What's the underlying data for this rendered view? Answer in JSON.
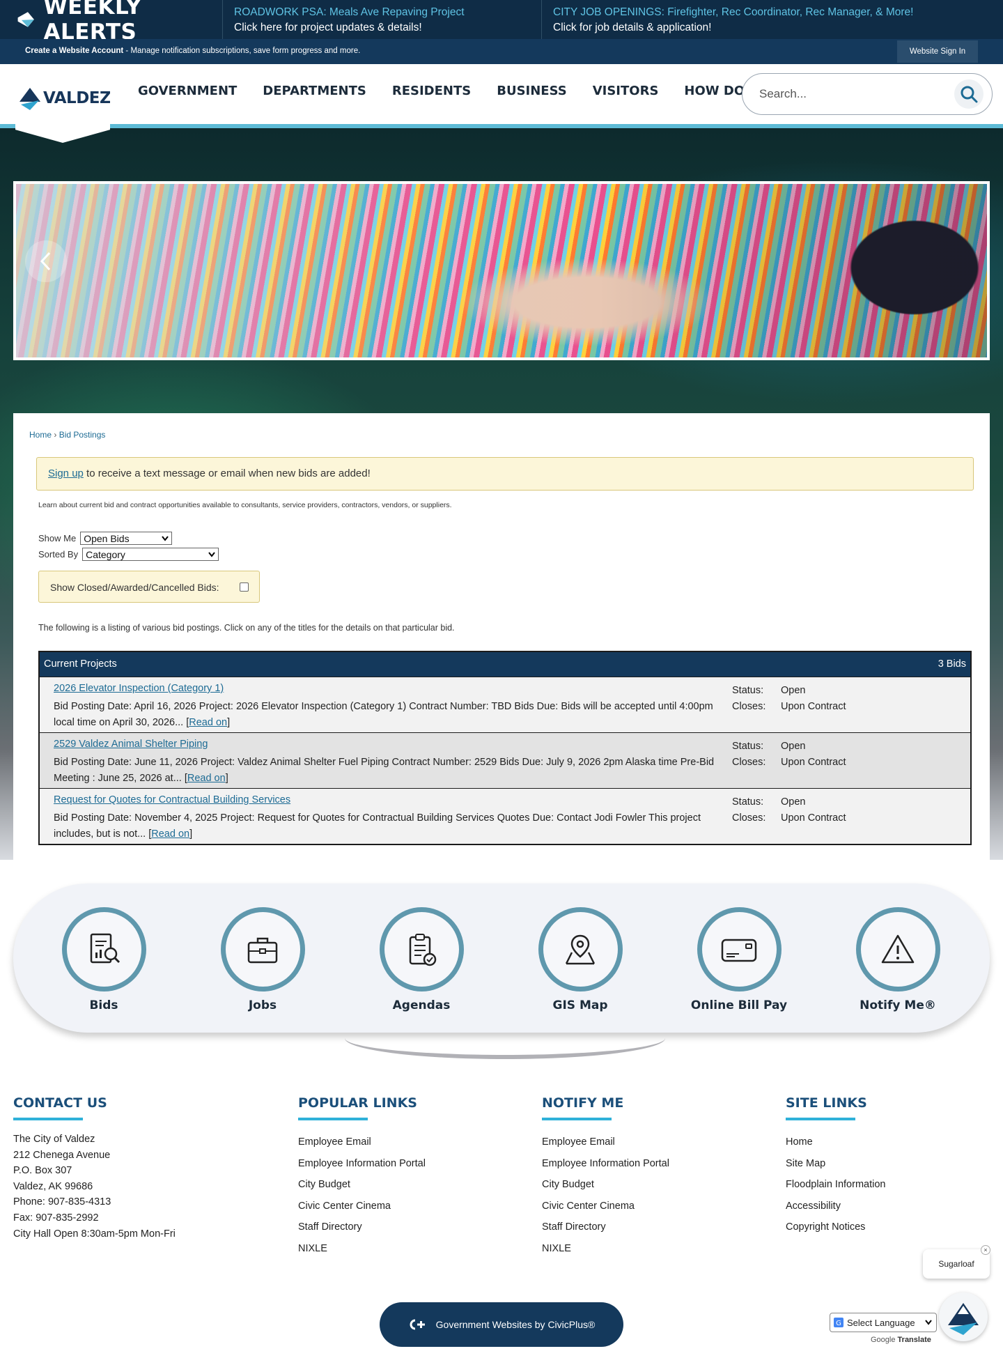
{
  "alerts": {
    "brand_title": "WEEKLY ALERTS",
    "items": [
      {
        "title": "ROADWORK PSA: Meals Ave Repaving Project",
        "subtitle": "Click here for project updates & details!"
      },
      {
        "title": "CITY JOB OPENINGS: Firefighter, Rec Coordinator, Rec Manager, & More!",
        "subtitle": "Click for job details & application!"
      }
    ]
  },
  "account": {
    "create_label": "Create a Website Account",
    "create_desc": " - Manage notification subscriptions, save form progress and more.",
    "signin_label": "Website Sign In"
  },
  "header": {
    "logo_text": "VALDEZ",
    "nav": [
      "GOVERNMENT",
      "DEPARTMENTS",
      "RESIDENTS",
      "BUSINESS",
      "VISITORS",
      "HOW DO I?"
    ],
    "search_placeholder": "Search..."
  },
  "hero": {
    "prev_icon": "chevron-left-icon"
  },
  "breadcrumb": {
    "home": "Home",
    "separator": " › ",
    "current": "Bid Postings"
  },
  "signup": {
    "link": "Sign up",
    "text": " to receive a text message or email when new bids are added!"
  },
  "intro_text": "Learn about current bid and contract opportunities available to consultants, service providers, contractors, vendors, or suppliers.",
  "filters": {
    "show_me_label": "Show Me",
    "show_me_value": "Open Bids",
    "sorted_by_label": "Sorted By",
    "sorted_by_value": "Category",
    "closed_label": "Show Closed/Awarded/Cancelled Bids:",
    "closed_checked": false
  },
  "listing_note": "The following is a listing of various bid postings. Click on any of the titles for the details on that particular bid.",
  "bids": {
    "category": "Current Projects",
    "count": "3 Bids",
    "status_label": "Status:",
    "closes_label": "Closes:",
    "read_on": "Read on",
    "rows": [
      {
        "title": "2026 Elevator Inspection (Category 1)",
        "desc": "Bid Posting Date: April 16, 2026 Project: 2026 Elevator Inspection (Category 1) Contract Number: TBD Bids Due: Bids will be accepted until 4:00pm local time on April 30, 2026... ",
        "status": "Open",
        "closes": "Upon Contract"
      },
      {
        "title": "2529 Valdez Animal Shelter Piping",
        "desc": "Bid Posting Date: June 11, 2026 Project: Valdez Animal Shelter Fuel Piping Contract Number: 2529 Bids Due: July 9, 2026 2pm Alaska time Pre-Bid Meeting : June 25, 2026 at... ",
        "status": "Open",
        "closes": "Upon Contract"
      },
      {
        "title": "Request for Quotes for Contractual Building Services",
        "desc": "Bid Posting Date: November 4, 2025 Project: Request for Quotes for Contractual Building Services Quotes Due: Contact Jodi Fowler This project includes, but is not... ",
        "status": "Open",
        "closes": "Upon Contract"
      }
    ]
  },
  "quick_links": [
    {
      "label": "Bids",
      "icon": "bids-document-icon"
    },
    {
      "label": "Jobs",
      "icon": "briefcase-icon"
    },
    {
      "label": "Agendas",
      "icon": "clipboard-check-icon"
    },
    {
      "label": "GIS Map",
      "icon": "map-pin-icon"
    },
    {
      "label": "Online Bill Pay",
      "icon": "credit-card-icon"
    },
    {
      "label": "Notify Me®",
      "icon": "warning-triangle-icon"
    }
  ],
  "footer": {
    "contact": {
      "heading": "CONTACT US",
      "lines": [
        "The City of Valdez",
        "212 Chenega Avenue",
        "P.O. Box 307",
        "Valdez, AK 99686",
        "Phone: 907-835-4313",
        "Fax: 907-835-2992",
        "City Hall Open 8:30am-5pm Mon-Fri"
      ]
    },
    "popular": {
      "heading": "POPULAR LINKS",
      "links": [
        "Employee Email",
        "Employee Information Portal",
        "City Budget",
        "Civic Center Cinema",
        "Staff Directory",
        "NIXLE"
      ]
    },
    "notify": {
      "heading": "NOTIFY ME",
      "links": [
        "Employee Email",
        "Employee Information Portal",
        "City Budget",
        "Civic Center Cinema",
        "Staff Directory",
        "NIXLE"
      ]
    },
    "site": {
      "heading": "SITE LINKS",
      "links": [
        "Home",
        "Site Map",
        "Floodplain Information",
        "Accessibility",
        "Copyright Notices"
      ]
    },
    "civicplus": "Government Websites by CivicPlus®",
    "language": "Select Language",
    "powered_by": "Google",
    "translate": "Translate",
    "chat_name": "Sugarloaf",
    "chat_close": "×"
  },
  "colors": {
    "navy": "#14395c",
    "alert_bg": "#0f2c46",
    "accent": "#5dbbd6",
    "link": "#1d6b94",
    "notice_bg": "#fcf6d9"
  }
}
